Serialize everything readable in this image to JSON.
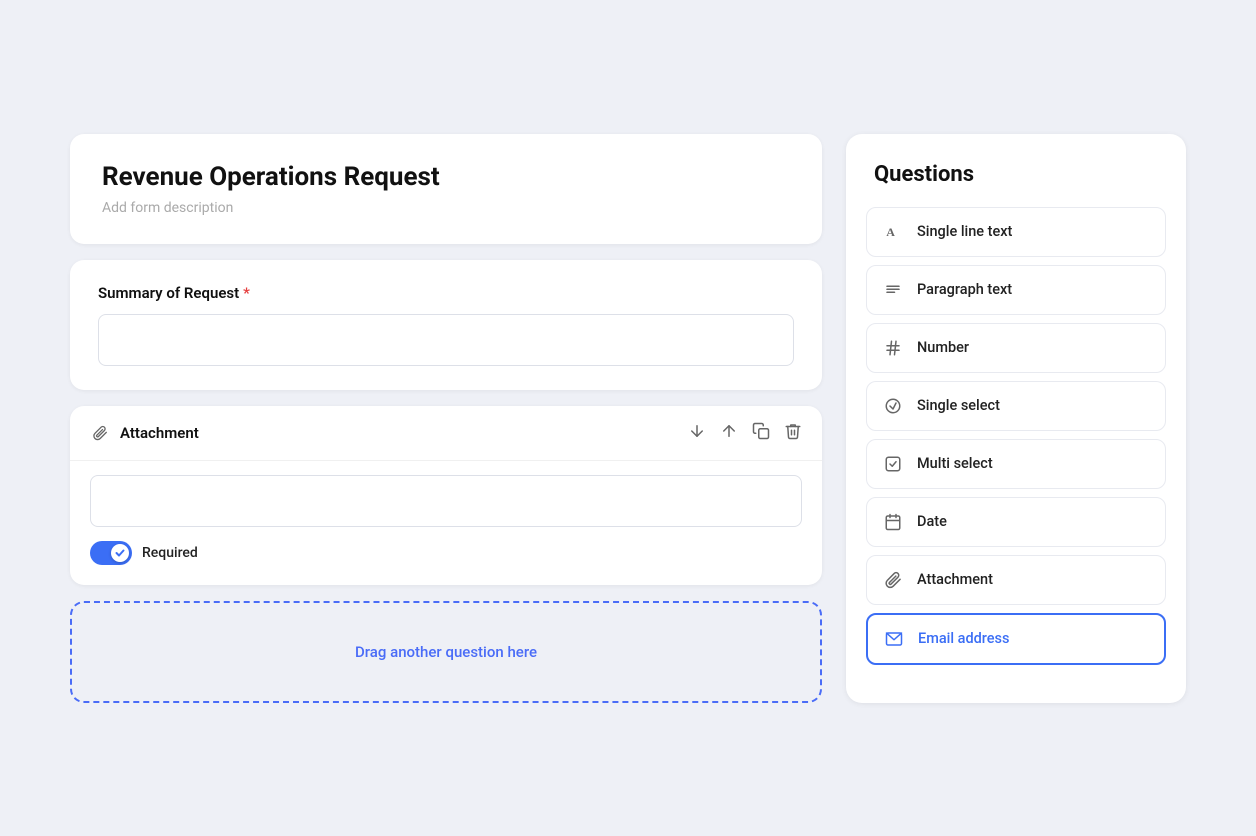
{
  "form": {
    "title": "Revenue Operations Request",
    "description_placeholder": "Add form description",
    "fields": [
      {
        "id": "summary",
        "label": "Summary of Request",
        "required": true,
        "type": "text",
        "placeholder": ""
      },
      {
        "id": "attachment",
        "label": "Attachment",
        "required_toggle": true,
        "required_label": "Required"
      }
    ],
    "drop_zone_text": "Drag another question here"
  },
  "questions_panel": {
    "title": "Questions",
    "items": [
      {
        "id": "single-line-text",
        "label": "Single line text",
        "icon": "A"
      },
      {
        "id": "paragraph-text",
        "label": "Paragraph text",
        "icon": "para"
      },
      {
        "id": "number",
        "label": "Number",
        "icon": "hash"
      },
      {
        "id": "single-select",
        "label": "Single select",
        "icon": "chevron-circle"
      },
      {
        "id": "multi-select",
        "label": "Multi select",
        "icon": "checkbox"
      },
      {
        "id": "date",
        "label": "Date",
        "icon": "calendar"
      },
      {
        "id": "attachment",
        "label": "Attachment",
        "icon": "paperclip"
      },
      {
        "id": "email-address",
        "label": "Email address",
        "icon": "envelope"
      }
    ]
  },
  "colors": {
    "accent": "#3b6ef5",
    "required": "#e53e3e",
    "border": "#e8eaf0",
    "text_primary": "#111111",
    "text_muted": "#aaaaaa"
  }
}
